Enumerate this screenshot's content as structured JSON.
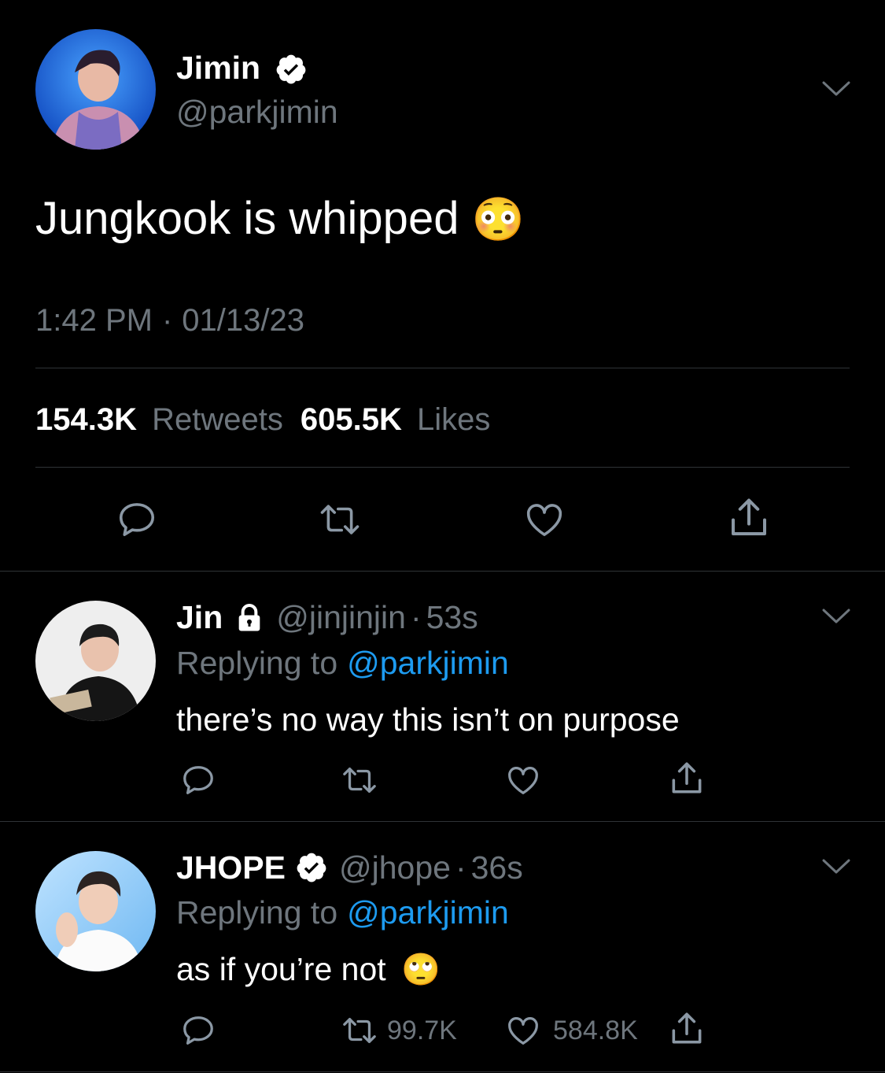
{
  "main_tweet": {
    "display_name": "Jimin",
    "handle": "@parkjimin",
    "text": "Jungkook is whipped",
    "emoji": "😳",
    "time": "1:42 PM",
    "separator": "·",
    "date": "01/13/23",
    "retweets_count": "154.3K",
    "retweets_label": "Retweets",
    "likes_count": "605.5K",
    "likes_label": "Likes"
  },
  "replies": [
    {
      "display_name": "Jin",
      "locked": true,
      "handle": "@jinjinjin",
      "separator": "·",
      "age": "53s",
      "replying_to_label": "Replying to",
      "replying_to_handle": "@parkjimin",
      "text": "there’s no way this isn’t on purpose"
    },
    {
      "display_name": "JHOPE",
      "verified": true,
      "handle": "@jhope",
      "separator": "·",
      "age": "36s",
      "replying_to_label": "Replying to",
      "replying_to_handle": "@parkjimin",
      "text": "as if you’re not",
      "emoji": "🙄",
      "retweets_count": "99.7K",
      "likes_count": "584.8K"
    }
  ],
  "colors": {
    "background": "#000000",
    "muted": "#6e767d",
    "link": "#1d9bf0",
    "divider": "#2f3336"
  }
}
